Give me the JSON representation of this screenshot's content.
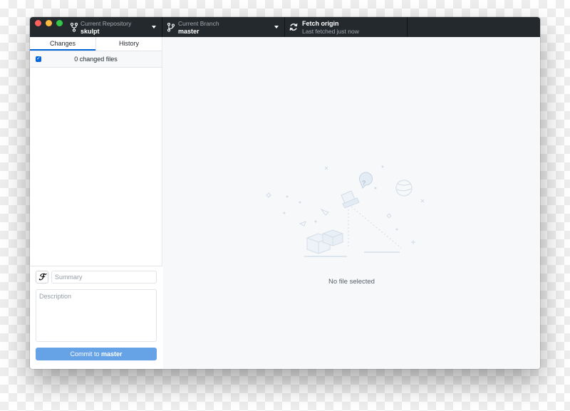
{
  "toolbar": {
    "repo_label": "Current Repository",
    "repo_value": "skulpt",
    "branch_label": "Current Branch",
    "branch_value": "master",
    "fetch_label": "Fetch origin",
    "fetch_status": "Last fetched just now"
  },
  "sidebar": {
    "tabs": [
      {
        "label": "Changes",
        "active": true
      },
      {
        "label": "History",
        "active": false
      }
    ],
    "changes_count_text": "0 changed files",
    "select_all_checked": true
  },
  "commit": {
    "summary_placeholder": "Summary",
    "description_placeholder": "Description",
    "button_prefix": "Commit to ",
    "button_branch": "master"
  },
  "main": {
    "empty_text": "No file selected"
  },
  "colors": {
    "toolbar_bg": "#24292e",
    "accent": "#0366d6",
    "commit_button": "#66a2e6",
    "main_bg": "#f6f8fa"
  },
  "icons": {
    "repo": "repo-icon",
    "branch": "git-branch-icon",
    "fetch": "sync-icon",
    "dropdown": "triangle-down-icon"
  }
}
